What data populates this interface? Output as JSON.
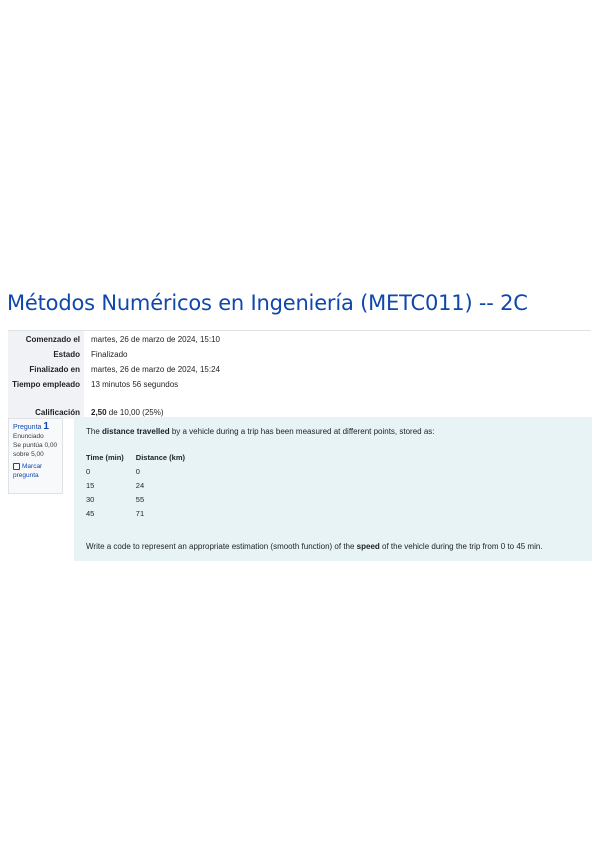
{
  "page_title": "Métodos Numéricos en Ingeniería (METC011) -- 2C",
  "summary": [
    {
      "label": "Comenzado el",
      "value": "martes, 26 de marzo de 2024, 15:10"
    },
    {
      "label": "Estado",
      "value": "Finalizado"
    },
    {
      "label": "Finalizado en",
      "value": "martes, 26 de marzo de 2024, 15:24"
    },
    {
      "label": "Tiempo empleado",
      "value": "13 minutos 56 segundos"
    },
    {
      "label": "Calificación",
      "value_bold": "2,50",
      "value_rest": " de 10,00 (25%)"
    }
  ],
  "question_info": {
    "prefix": "Pregunta",
    "number": "1",
    "state": "Enunciado",
    "mark": "Se puntúa 0,00 sobre 5,00",
    "flag": "Marcar pregunta"
  },
  "question": {
    "intro_pre": "The ",
    "intro_bold": "distance travelled",
    "intro_post": " by a vehicle during a trip has been measured at different points, stored as:",
    "table_headers": [
      "Time (min)",
      "Distance (km)"
    ],
    "table_rows": [
      [
        "0",
        "0"
      ],
      [
        "15",
        "24"
      ],
      [
        "30",
        "55"
      ],
      [
        "45",
        "71"
      ]
    ],
    "prompt_pre": "Write a code to represent an appropriate estimation (smooth function) of the ",
    "prompt_bold": "speed",
    "prompt_post": " of the vehicle during the trip from 0 to 45 min."
  }
}
